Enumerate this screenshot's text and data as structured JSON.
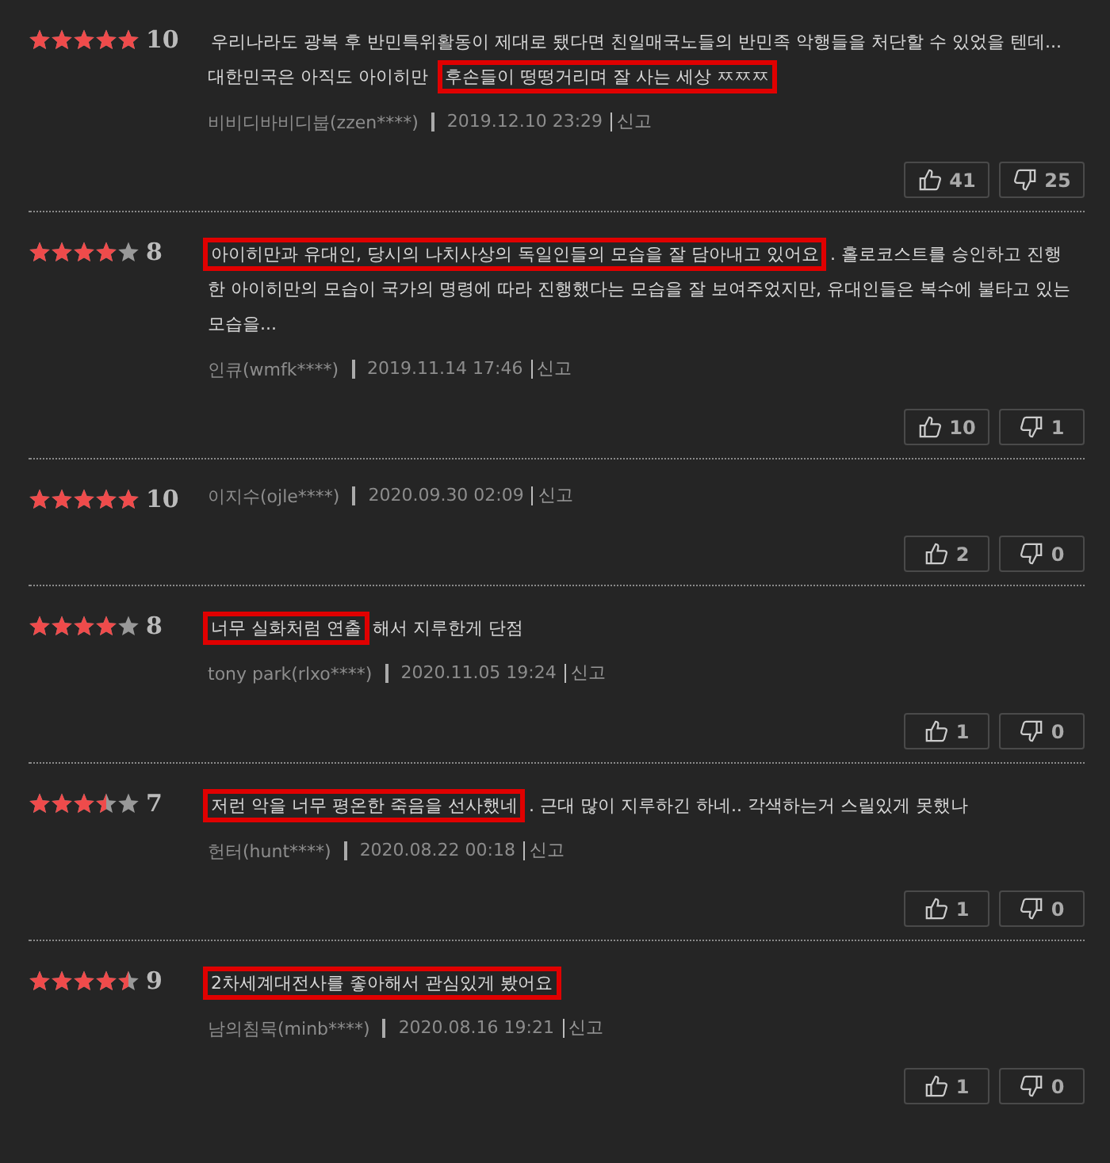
{
  "reviews": [
    {
      "stars": 5,
      "score": "10",
      "comment": [
        {
          "text": "우리나라도 광복 후 반민특위활동이 제대로 됐다면 친일매국노들의 반민족 악행들을 처단할 수 있었을 텐데... 대한민국은 아직도 아이히만 ",
          "highlighted": false
        },
        {
          "text": "후손들이 떵떵거리며 잘 사는 세상 ㅉㅉㅉ",
          "highlighted": true
        }
      ],
      "author": "비비디바비디붑(zzen****)",
      "date": "2019.12.10 23:29",
      "report": "신고",
      "likes": "41",
      "dislikes": "25"
    },
    {
      "stars": 4,
      "score": "8",
      "comment": [
        {
          "text": "아이히만과 유대인, 당시의 나치사상의 독일인들의 모습을 잘 담아내고 있어요",
          "highlighted": true
        },
        {
          "text": ". 홀로코스트를 승인하고 진행한 아이히만의 모습이 국가의 명령에 따라 진행했다는 모습을 잘 보여주었지만, 유대인들은 복수에 불타고 있는 모습을...",
          "highlighted": false
        }
      ],
      "author": "인큐(wmfk****)",
      "date": "2019.11.14 17:46",
      "report": "신고",
      "likes": "10",
      "dislikes": "1"
    },
    {
      "stars": 5,
      "score": "10",
      "author": "이지수(ojle****)",
      "date": "2020.09.30 02:09",
      "report": "신고",
      "likes": "2",
      "dislikes": "0"
    },
    {
      "stars": 4,
      "score": "8",
      "comment": [
        {
          "text": "너무 실화처럼 연출",
          "highlighted": true
        },
        {
          "text": "해서 지루한게 단점",
          "highlighted": false
        }
      ],
      "author": "tony park(rlxo****)",
      "date": "2020.11.05 19:24",
      "report": "신고",
      "likes": "1",
      "dislikes": "0"
    },
    {
      "stars": 3.5,
      "score": "7",
      "comment": [
        {
          "text": "저런 악을 너무 평온한 죽음을 선사했네",
          "highlighted": true
        },
        {
          "text": ". 근대 많이 지루하긴 하네.. 각색하는거 스릴있게 못했나",
          "highlighted": false
        }
      ],
      "author": "헌터(hunt****)",
      "date": "2020.08.22 00:18",
      "report": "신고",
      "likes": "1",
      "dislikes": "0"
    },
    {
      "stars": 4.5,
      "score": "9",
      "comment": [
        {
          "text": "2차세계대전사를 좋아해서 관심있게 봤어요",
          "highlighted": true
        }
      ],
      "author": "남의침묵(minb****)",
      "date": "2020.08.16 19:21",
      "report": "신고",
      "likes": "1",
      "dislikes": "0"
    }
  ]
}
